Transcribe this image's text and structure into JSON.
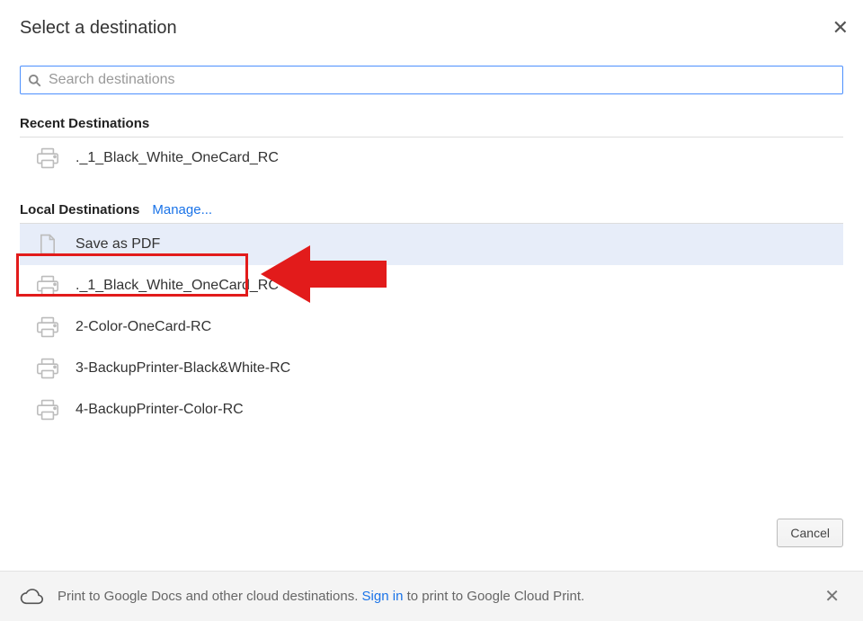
{
  "title": "Select a destination",
  "search": {
    "placeholder": "Search destinations"
  },
  "sections": {
    "recent": {
      "header": "Recent Destinations",
      "items": [
        {
          "label": "._1_Black_White_OneCard_RC",
          "icon": "printer"
        }
      ]
    },
    "local": {
      "header": "Local Destinations",
      "manage": "Manage...",
      "items": [
        {
          "label": "Save as PDF",
          "icon": "page",
          "highlighted": true
        },
        {
          "label": "._1_Black_White_OneCard_RC",
          "icon": "printer"
        },
        {
          "label": "2-Color-OneCard-RC",
          "icon": "printer"
        },
        {
          "label": "3-BackupPrinter-Black&White-RC",
          "icon": "printer"
        },
        {
          "label": "4-BackupPrinter-Color-RC",
          "icon": "printer"
        }
      ]
    }
  },
  "cancel": "Cancel",
  "cloud": {
    "text_before": "Print to Google Docs and other cloud destinations. ",
    "link": "Sign in",
    "text_after": " to print to Google Cloud Print."
  },
  "annotation": {
    "type": "callout",
    "target": "save-as-pdf",
    "shape": "red-box-arrow"
  }
}
